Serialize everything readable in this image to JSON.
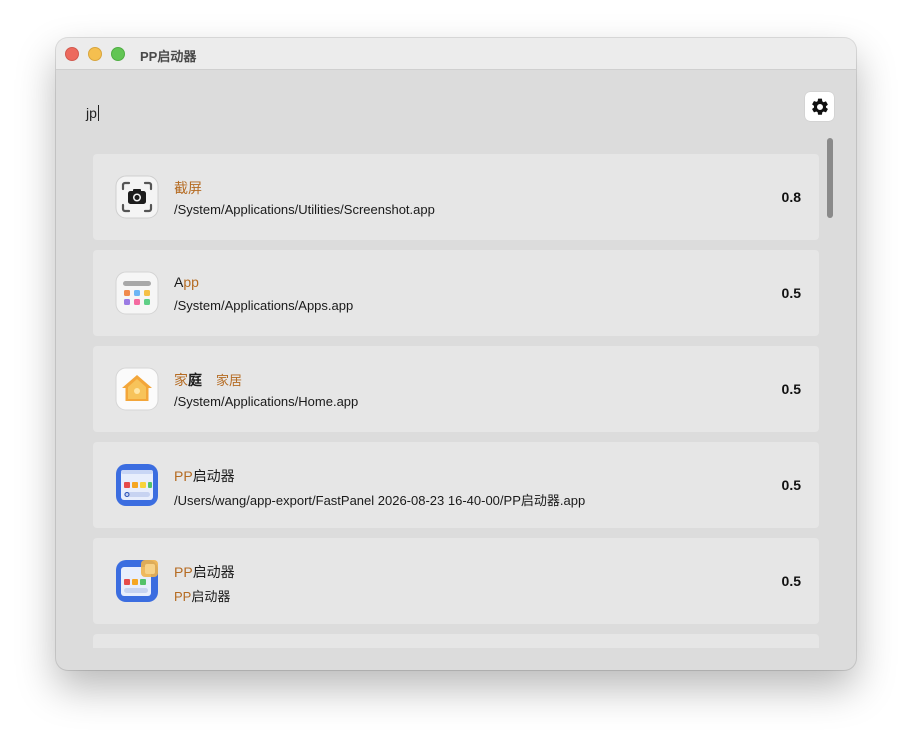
{
  "window": {
    "title": "PP启动器"
  },
  "search": {
    "value": "jp"
  },
  "settings": {
    "icon": "gear-icon"
  },
  "results": [
    {
      "name": "截屏",
      "name_parts": [
        {
          "t": "截屏",
          "hl": true
        }
      ],
      "path": "/System/Applications/Utilities/Screenshot.app",
      "score": "0.8",
      "icon": "screenshot-app-icon"
    },
    {
      "name": "App",
      "name_parts": [
        {
          "t": "A",
          "hl": false
        },
        {
          "t": "pp",
          "hl": true
        }
      ],
      "path": "/System/Applications/Apps.app",
      "score": "0.5",
      "icon": "apps-app-icon"
    },
    {
      "name": "家庭 家居",
      "name_parts": [
        {
          "t": "家",
          "hl": true
        },
        {
          "t": "庭",
          "hl": false
        },
        {
          "t": "　",
          "hl": false
        },
        {
          "t": "家居",
          "hl": true
        }
      ],
      "path": "/System/Applications/Home.app",
      "score": "0.5",
      "icon": "home-app-icon"
    },
    {
      "name": "PP启动器",
      "name_parts": [
        {
          "t": "PP",
          "hl": true
        },
        {
          "t": "启动器",
          "hl": false
        }
      ],
      "path": "/Users/wang/app-export/FastPanel 2026-08-23 16-40-00/PP启动器.app",
      "path_parts": [
        {
          "t": "/Users/wang/app-export/FastPanel 2026-08-23 16-40-00/PP启动器.app",
          "hl": false
        }
      ],
      "score": "0.5",
      "icon": "pp-launcher-app-icon"
    },
    {
      "name": "PP启动器",
      "name_parts": [
        {
          "t": "PP",
          "hl": true
        },
        {
          "t": "启动器",
          "hl": false
        }
      ],
      "path": "PP启动器",
      "path_parts": [
        {
          "t": "PP",
          "hl": true
        },
        {
          "t": "启动器",
          "hl": false
        }
      ],
      "score": "0.5",
      "icon": "pp-launcher-app-icon"
    }
  ],
  "colors": {
    "highlight": "#b56b22",
    "window_bg": "#dcdcdc",
    "row_bg": "#e6e6e6"
  }
}
